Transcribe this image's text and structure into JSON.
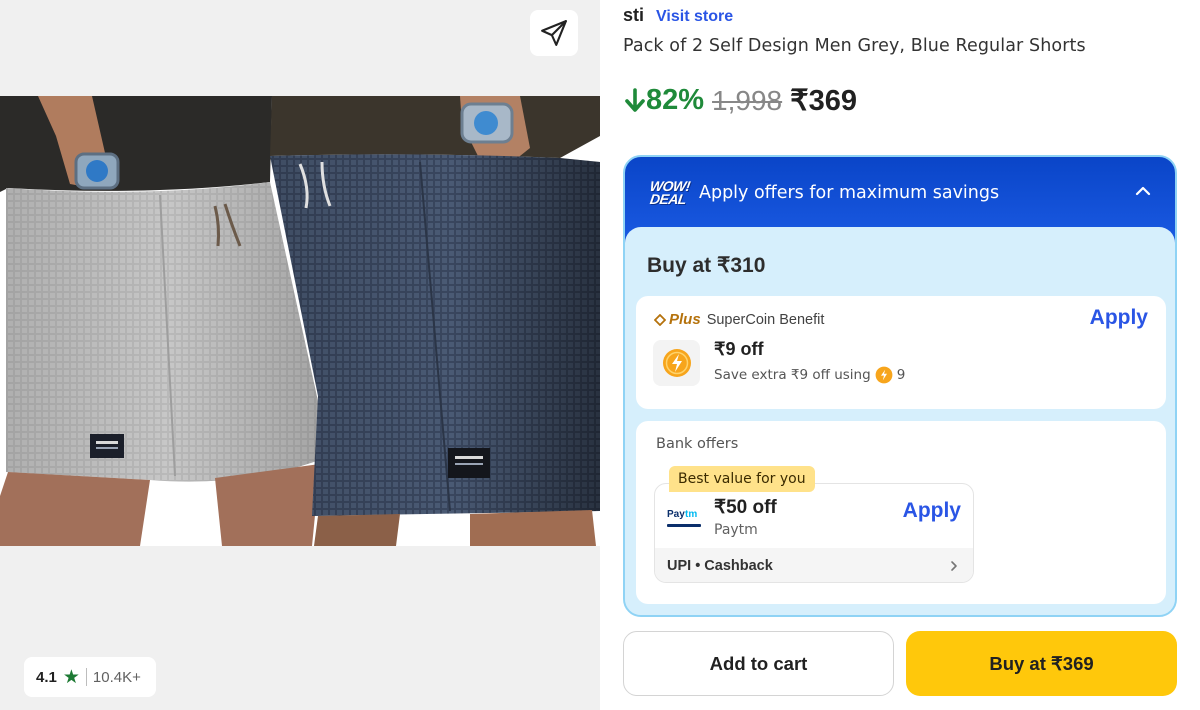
{
  "gallery": {
    "image_alt": "Pack of 2 Self Design Men Grey, Blue Regular Shorts",
    "share_icon": "share-paper-plane-icon",
    "rating": {
      "value": "4.1",
      "count": "10.4K+",
      "star_color": "#1e7a34"
    }
  },
  "product": {
    "brand": "sti",
    "visit_store_label": "Visit store",
    "title": "Pack of 2 Self Design Men Grey, Blue Regular Shorts",
    "discount": "82%",
    "mrp": "1,998",
    "price": "₹369"
  },
  "offers": {
    "badge_line1": "WOW!",
    "badge_line2": "DEAL",
    "header_text": "Apply offers for maximum savings",
    "buy_at_label": "Buy at ₹310",
    "supercoin": {
      "plus_label": "Plus",
      "label": "SuperCoin Benefit",
      "apply_label": "Apply",
      "off_text": "₹9 off",
      "sub_text": "Save extra ₹9 off using",
      "coins": "9"
    },
    "bank": {
      "title": "Bank offers",
      "tag": "Best value for you",
      "off_text": "₹50 off",
      "provider": "Paytm",
      "apply_label": "Apply",
      "method": "UPI • Cashback"
    }
  },
  "actions": {
    "add_to_cart_label": "Add to cart",
    "buy_now_label": "Buy at ₹369"
  },
  "colors": {
    "accent_blue": "#2a55e5",
    "discount_green": "#1f8a3a",
    "buy_yellow": "#ffc80b",
    "offer_header_blue": "#0a45c8"
  }
}
